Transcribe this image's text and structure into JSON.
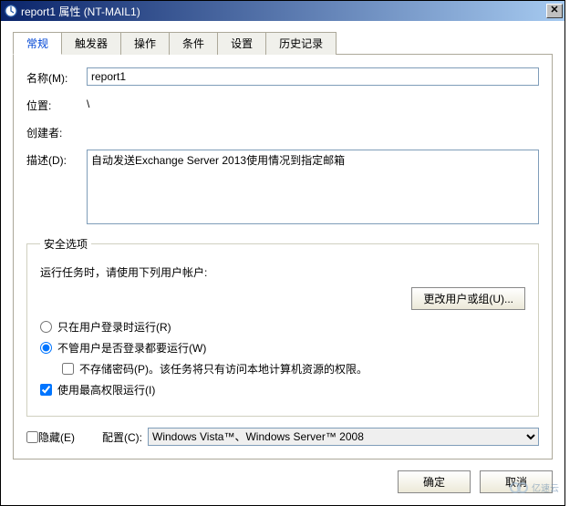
{
  "titlebar": {
    "title": "report1 属性 (NT-MAIL1)",
    "close_glyph": "✕"
  },
  "tabs": {
    "general": "常规",
    "triggers": "触发器",
    "actions": "操作",
    "conditions": "条件",
    "settings": "设置",
    "history": "历史记录"
  },
  "general": {
    "name_label": "名称(M):",
    "name_value": "report1",
    "location_label": "位置:",
    "location_value": "\\",
    "author_label": "创建者:",
    "author_value": "",
    "description_label": "描述(D):",
    "description_value": "自动发送Exchange Server 2013使用情况到指定邮箱"
  },
  "security": {
    "legend": "安全选项",
    "prompt": "运行任务时，请使用下列用户帐户:",
    "account": "",
    "change_user_btn": "更改用户或组(U)...",
    "only_logged_on": "只在用户登录时运行(R)",
    "run_regardless": "不管用户是否登录都要运行(W)",
    "do_not_store_pwd": "不存储密码(P)。该任务将只有访问本地计算机资源的权限。",
    "highest_priv": "使用最高权限运行(I)"
  },
  "bottom": {
    "hidden": "隐藏(E)",
    "configure_label": "配置(C):",
    "configure_value": "Windows Vista™、Windows Server™ 2008"
  },
  "buttons": {
    "ok": "确定",
    "cancel": "取消"
  },
  "watermark": "亿速云"
}
